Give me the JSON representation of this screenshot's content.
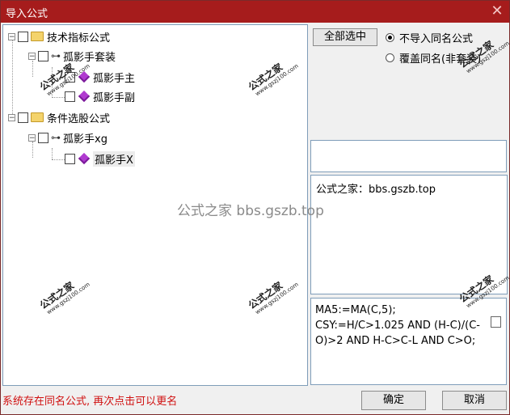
{
  "window": {
    "title": "导入公式",
    "close_glyph": "✕"
  },
  "tree": {
    "items": [
      {
        "label": "技术指标公式",
        "type": "folder",
        "expander": "−"
      },
      {
        "label": "孤影手套装",
        "type": "key",
        "expander": "−"
      },
      {
        "label": "孤影手主",
        "type": "gem"
      },
      {
        "label": "孤影手副",
        "type": "gem"
      },
      {
        "label": "条件选股公式",
        "type": "folder",
        "expander": "−"
      },
      {
        "label": "孤影手xg",
        "type": "key",
        "expander": "−"
      },
      {
        "label": "孤影手X",
        "type": "gem"
      }
    ]
  },
  "controls": {
    "select_all_label": "全部选中",
    "radio_options": [
      {
        "label": "不导入同名公式",
        "selected": true
      },
      {
        "label": "覆盖同名(非套装)",
        "selected": false
      }
    ]
  },
  "info_text": "公式之家：bbs.gszb.top",
  "formula_text": "MA5:=MA(C,5);\nCSY:=H/C>1.025 AND (H-C)/(C-O)>2 AND H-C>C-L AND C>O;",
  "status_message": "系统存在同名公式, 再次点击可以更名",
  "buttons": {
    "ok": "确定",
    "cancel": "取消"
  },
  "watermarks": {
    "stamp_big": "公式之家",
    "stamp_small": "www.gszj100.com",
    "center_text": "公式之家 bbs.gszb.top"
  }
}
